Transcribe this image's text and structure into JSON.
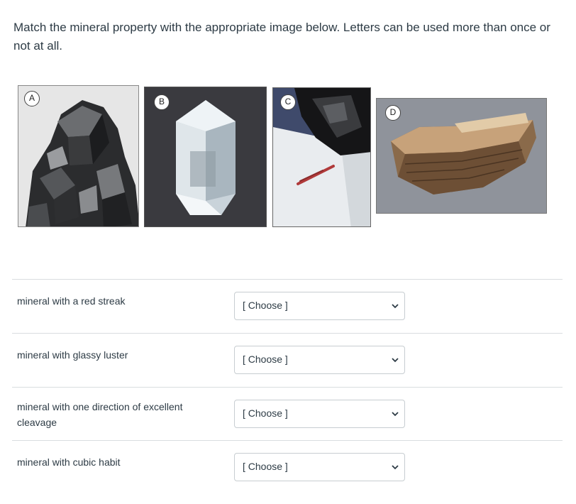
{
  "question": {
    "text": "Match the mineral property with the appropriate image below. Letters can be used more than once or not at all."
  },
  "images": [
    {
      "letter": "A"
    },
    {
      "letter": "B"
    },
    {
      "letter": "C"
    },
    {
      "letter": "D"
    }
  ],
  "matches": [
    {
      "label": "mineral with a red streak",
      "value": "[ Choose ]"
    },
    {
      "label": "mineral with glassy luster",
      "value": "[ Choose ]"
    },
    {
      "label": "mineral with one direction of excellent cleavage",
      "value": "[ Choose ]"
    },
    {
      "label": "mineral with cubic habit",
      "value": "[ Choose ]"
    }
  ],
  "icons": {
    "dropdown": "chevron-down-icon"
  }
}
